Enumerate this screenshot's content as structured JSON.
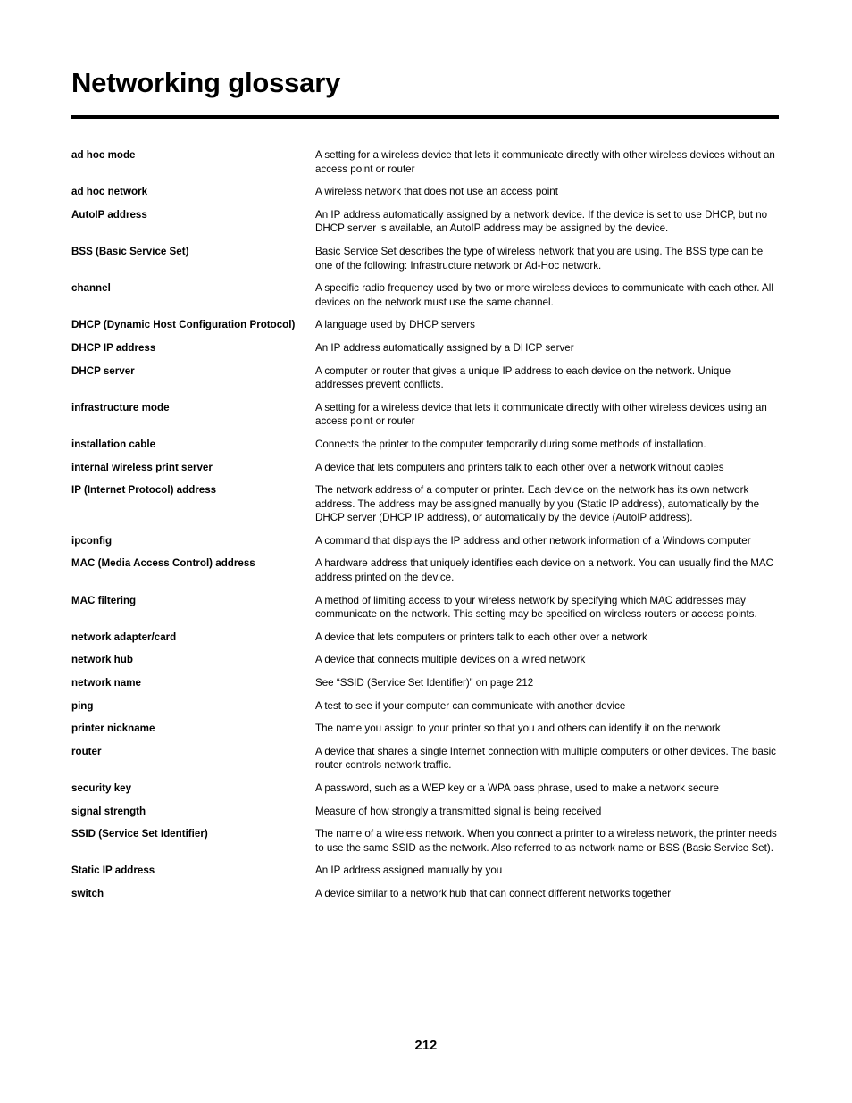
{
  "document": {
    "title": "Networking glossary",
    "page_number": "212"
  },
  "glossary": {
    "entries": [
      {
        "term": "ad hoc mode",
        "definition": "A setting for a wireless device that lets it communicate directly with other wireless devices without an access point or router"
      },
      {
        "term": "ad hoc network",
        "definition": "A wireless network that does not use an access point"
      },
      {
        "term": "AutoIP address",
        "definition": "An IP address automatically assigned by a network device. If the device is set to use DHCP, but no DHCP server is available, an AutoIP address may be assigned by the device."
      },
      {
        "term": "BSS (Basic Service Set)",
        "definition": "Basic Service Set describes the type of wireless network that you are using. The BSS type can be one of the following: Infrastructure network or Ad-Hoc network."
      },
      {
        "term": "channel",
        "definition": "A specific radio frequency used by two or more wireless devices to communicate with each other. All devices on the network must use the same channel."
      },
      {
        "term": "DHCP (Dynamic Host Configuration Protocol)",
        "definition": "A language used by DHCP servers"
      },
      {
        "term": "DHCP IP address",
        "definition": "An IP address automatically assigned by a DHCP server"
      },
      {
        "term": "DHCP server",
        "definition": "A computer or router that gives a unique IP address to each device on the network. Unique addresses prevent conflicts."
      },
      {
        "term": "infrastructure mode",
        "definition": "A setting for a wireless device that lets it communicate directly with other wireless devices using an access point or router"
      },
      {
        "term": "installation cable",
        "definition": "Connects the printer to the computer temporarily during some methods of installation."
      },
      {
        "term": "internal wireless print server",
        "definition": "A device that lets computers and printers talk to each other over a network without cables"
      },
      {
        "term": "IP (Internet Protocol) address",
        "definition": "The network address of a computer or printer. Each device on the network has its own network address. The address may be assigned manually by you (Static IP address), automatically by the DHCP server (DHCP IP address), or automatically by the device (AutoIP address)."
      },
      {
        "term": "ipconfig",
        "definition": "A command that displays the IP address and other network information of a Windows computer"
      },
      {
        "term": "MAC (Media Access Control) address",
        "definition": "A hardware address that uniquely identifies each device on a network. You can usually find the MAC address printed on the device."
      },
      {
        "term": "MAC filtering",
        "definition": "A method of limiting access to your wireless network by specifying which MAC addresses may communicate on the network. This setting may be specified on wireless routers or access points."
      },
      {
        "term": "network adapter/card",
        "definition": "A device that lets computers or printers talk to each other over a network"
      },
      {
        "term": "network hub",
        "definition": "A device that connects multiple devices on a wired network"
      },
      {
        "term": "network name",
        "definition": "See “SSID (Service Set Identifier)” on page 212"
      },
      {
        "term": "ping",
        "definition": "A test to see if your computer can communicate with another device"
      },
      {
        "term": "printer nickname",
        "definition": "The name you assign to your printer so that you and others can identify it on the network"
      },
      {
        "term": "router",
        "definition": "A device that shares a single Internet connection with multiple computers or other devices. The basic router controls network traffic."
      },
      {
        "term": "security key",
        "definition": "A password, such as a WEP key or a WPA pass phrase, used to make a network secure"
      },
      {
        "term": "signal strength",
        "definition": "Measure of how strongly a transmitted signal is being received"
      },
      {
        "term": "SSID (Service Set Identifier)",
        "definition": "The name of a wireless network. When you connect a printer to a wireless network, the printer needs to use the same SSID as the network. Also referred to as network name or BSS (Basic Service Set)."
      },
      {
        "term": "Static IP address",
        "definition": "An IP address assigned manually by you"
      },
      {
        "term": "switch",
        "definition": "A device similar to a network hub that can connect different networks together"
      }
    ]
  }
}
